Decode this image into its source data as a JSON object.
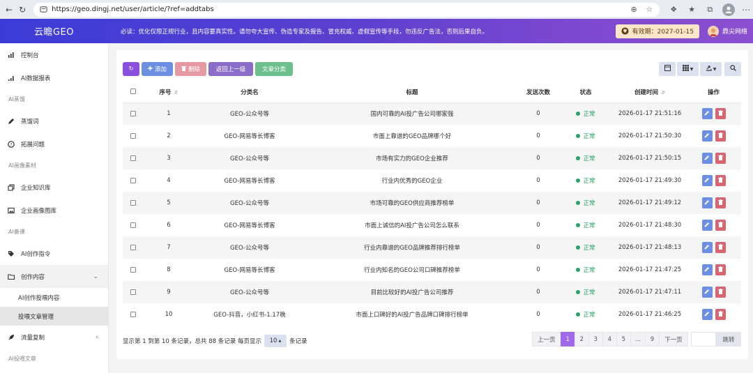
{
  "browser": {
    "url": "https://geo.dingj.net/user/article/?ref=addtabs"
  },
  "header": {
    "brand": "云瞻GEO",
    "notice": "必读：优化仅限正规行业，且内容要真实性。请勿夸大宣传、伪造专家及报告、冒充权威、虚假宣传等手段，勿违反广告法，否则后果自负。",
    "validity": "有效期：2027-01-15",
    "username": "鼎尖网络"
  },
  "sidebar": {
    "items": [
      {
        "label": "控制台"
      },
      {
        "label": "AI数据报表"
      }
    ],
    "section1": "AI蒸馏",
    "items2": [
      {
        "label": "蒸馏词"
      },
      {
        "label": "拓展问题"
      }
    ],
    "section2": "AI画像素材",
    "items3": [
      {
        "label": "企业知识库"
      },
      {
        "label": "企业画像图库"
      }
    ],
    "section3": "AI备课",
    "items4": [
      {
        "label": "AI创作指令"
      },
      {
        "label": "创作内容"
      }
    ],
    "sub": [
      {
        "label": "AI创作投喂内容"
      },
      {
        "label": "投喂文章管理"
      }
    ],
    "items5": [
      {
        "label": "流量复制"
      }
    ],
    "section4": "AI投喂文章"
  },
  "toolbar": {
    "add": "添加",
    "delete": "删除",
    "up": "返回上一级",
    "category": "文章分类"
  },
  "table": {
    "headers": [
      "序号",
      "分类名",
      "标题",
      "发送次数",
      "状态",
      "创建时间",
      "操作"
    ],
    "rows": [
      {
        "no": "1",
        "category": "GEO-公众号等",
        "title": "国内可靠的AI投广告公司哪家强",
        "sends": "0",
        "status": "正常",
        "created": "2026-01-17 21:51:16"
      },
      {
        "no": "2",
        "category": "GEO-网易等长博客",
        "title": "市面上靠谱的GEO品牌哪个好",
        "sends": "0",
        "status": "正常",
        "created": "2026-01-17 21:50:30"
      },
      {
        "no": "3",
        "category": "GEO-公众号等",
        "title": "市场有实力的GEO企业推荐",
        "sends": "0",
        "status": "正常",
        "created": "2026-01-17 21:50:15"
      },
      {
        "no": "4",
        "category": "GEO-网易等长博客",
        "title": "行业内优秀的GEO企业",
        "sends": "0",
        "status": "正常",
        "created": "2026-01-17 21:49:30"
      },
      {
        "no": "5",
        "category": "GEO-公众号等",
        "title": "市场可靠的GEO供应商推荐榜单",
        "sends": "0",
        "status": "正常",
        "created": "2026-01-17 21:49:12"
      },
      {
        "no": "6",
        "category": "GEO-网易等长博客",
        "title": "市面上诚信的AI投广告公司怎么联系",
        "sends": "0",
        "status": "正常",
        "created": "2026-01-17 21:48:30"
      },
      {
        "no": "7",
        "category": "GEO-公众号等",
        "title": "行业内靠谱的GEO品牌推荐排行榜单",
        "sends": "0",
        "status": "正常",
        "created": "2026-01-17 21:48:13"
      },
      {
        "no": "8",
        "category": "GEO-网易等长博客",
        "title": "行业内知名的GEO公司口碑推荐榜单",
        "sends": "0",
        "status": "正常",
        "created": "2026-01-17 21:47:25"
      },
      {
        "no": "9",
        "category": "GEO-公众号等",
        "title": "目前比较好的AI投广告公司推荐",
        "sends": "0",
        "status": "正常",
        "created": "2026-01-17 21:47:11"
      },
      {
        "no": "10",
        "category": "GEO-抖音，小红书-1.17晚",
        "title": "市面上口碑好的AI投广告品牌口碑排行榜单",
        "sends": "0",
        "status": "正常",
        "created": "2026-01-17 21:46:25"
      }
    ]
  },
  "footer": {
    "info_prefix": "显示第 1 到第 10 条记录，总共 88 条记录 每页显示",
    "page_size": "10",
    "info_suffix": "条记录",
    "prev": "上一页",
    "pages": [
      "1",
      "2",
      "3",
      "4",
      "5",
      "...",
      "9"
    ],
    "next": "下一页",
    "jump": "跳转"
  },
  "colors": {
    "header_start": "#3b3cd8",
    "header_end": "#8b4fd1",
    "status_ok": "#29a36a",
    "page_active": "#a16ae8"
  }
}
